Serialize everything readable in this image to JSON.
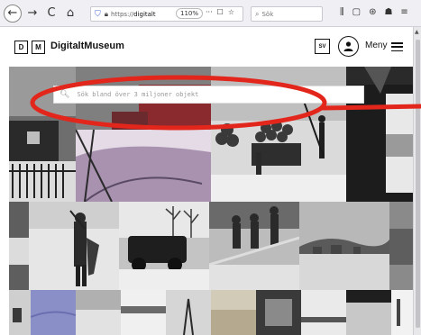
{
  "browser": {
    "back_glyph": "←",
    "forward_glyph": "→",
    "reload_glyph": "C",
    "home_glyph": "⌂",
    "url_prefix": "https://",
    "url_domain": "digitalt",
    "zoom": "110%",
    "more_glyph": "···",
    "pocket_glyph": "☐",
    "star_glyph": "☆",
    "search_placeholder": "Sök",
    "toolbar_glyphs": [
      "⫼",
      "▢",
      "⊛",
      "☗",
      "≡"
    ]
  },
  "site": {
    "logo_d": "D",
    "logo_m": "M",
    "name": "DigitaltMuseum",
    "language": "SV",
    "menu_label": "Meny"
  },
  "search": {
    "placeholder": "Sök bland över 3 miljoner objekt"
  },
  "colors": {
    "annotation": "#e3261c",
    "header_text": "#111111"
  },
  "icons": {
    "back": "back-arrow-icon",
    "forward": "forward-arrow-icon",
    "reload": "reload-icon",
    "home": "home-icon",
    "shield": "shield-icon",
    "lock": "lock-icon",
    "user": "user-icon",
    "menu": "hamburger-menu-icon",
    "search": "search-icon"
  }
}
